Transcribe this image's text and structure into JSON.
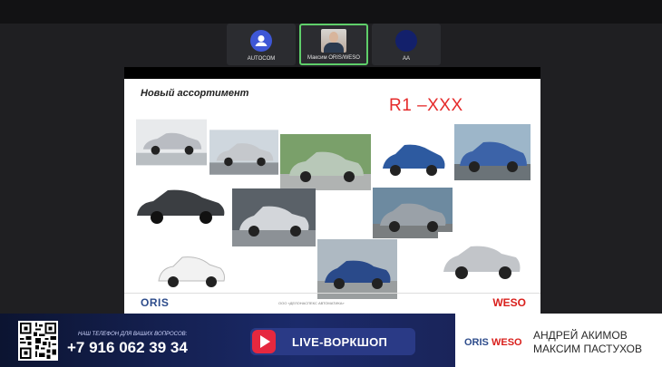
{
  "participants": [
    {
      "name": "AUTOCOM",
      "type": "avatar-blue",
      "active": false
    },
    {
      "name": "Максим ORIS/WESO",
      "type": "video",
      "active": true
    },
    {
      "name": "AA",
      "type": "avatar-navy",
      "active": false
    }
  ],
  "slide": {
    "title": "Новый ассортимент",
    "code": "R1 –XXX",
    "footer_left_logo": "ORIS",
    "footer_text": "ООО «ДЕЛОНАСПЕКС АВТОМАТИКА»",
    "footer_right_logo": "WESO",
    "cars": [
      {
        "color": "#b9bcc2"
      },
      {
        "color": "#c5c8cc"
      },
      {
        "color": "#b8c8b8"
      },
      {
        "color": "#2d5aa0"
      },
      {
        "color": "#3c63a8"
      },
      {
        "color": "#3b3e42"
      },
      {
        "color": "#d3d6da"
      },
      {
        "color": "#9aa1a8"
      },
      {
        "color": "#f2f2f2"
      },
      {
        "color": "#2a4a8a"
      },
      {
        "color": "#c2c5c9"
      }
    ]
  },
  "banner": {
    "phone_caption": "НАШ ТЕЛЕФОН ДЛЯ ВАШИХ ВОПРОСОВ:",
    "phone": "+7 916 062 39 34",
    "live_label": "LIVE-ВОРКШОП",
    "logo_oris": "ORIS",
    "logo_weso": "WESO",
    "speaker1": "АНДРЕЙ АКИМОВ",
    "speaker2": "МАКСИМ ПАСТУХОВ"
  }
}
